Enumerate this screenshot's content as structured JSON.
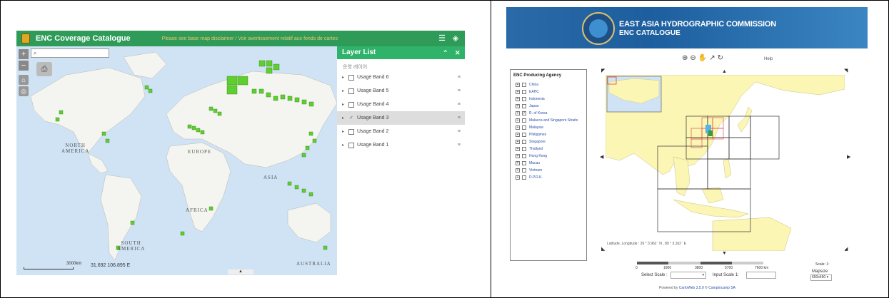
{
  "left": {
    "header": {
      "title": "ENC Coverage Catalogue",
      "disclaimer": "Please see base map disclaimer / Voir avertissement relatif aux fonds de cartes"
    },
    "map": {
      "search_icon": "search-icon",
      "zoom_in": "+",
      "zoom_out": "−",
      "labels": {
        "north_america": "NORTH\nAMERICA",
        "europe": "EUROPE",
        "asia": "ASIA",
        "africa": "AFRICA",
        "south_america": "SOUTH\nAMERICA",
        "australia": "AUSTRALIA"
      },
      "scale": "3000km",
      "coordinates": "31.692 106.895 E",
      "coverage_color": "#5fcf2f"
    },
    "layer_list": {
      "title": "Layer List",
      "subtitle": "운영 레이어",
      "items": [
        {
          "label": "Usage Band 6",
          "checked": false,
          "active": false
        },
        {
          "label": "Usage Band 5",
          "checked": false,
          "active": false
        },
        {
          "label": "Usage Band 4",
          "checked": false,
          "active": false
        },
        {
          "label": "Usage Band 3",
          "checked": true,
          "active": true
        },
        {
          "label": "Usage Band 2",
          "checked": false,
          "active": false
        },
        {
          "label": "Usage Band 1",
          "checked": false,
          "active": false
        }
      ]
    }
  },
  "right": {
    "banner": {
      "title_line1": "EAST ASIA HYDROGRAPHIC COMMISSION",
      "title_line2": "ENC CATALOGUE"
    },
    "toolbar": {
      "icons": [
        "zoom-in-icon",
        "zoom-out-icon",
        "pan-icon",
        "select-icon",
        "refresh-icon"
      ],
      "help": "Help"
    },
    "sidebar": {
      "title": "ENC Producing Agency",
      "items": [
        {
          "label": "China",
          "checked": false
        },
        {
          "label": "EAHC",
          "checked": false
        },
        {
          "label": "Indonesia",
          "checked": false
        },
        {
          "label": "Japan",
          "checked": false
        },
        {
          "label": "R. of Korea",
          "checked": true
        },
        {
          "label": "Malacca and Singapore Straits",
          "checked": false
        },
        {
          "label": "Malaysia",
          "checked": false
        },
        {
          "label": "Philippines",
          "checked": false
        },
        {
          "label": "Singapore",
          "checked": false
        },
        {
          "label": "Thailand",
          "checked": false
        },
        {
          "label": "Hong Kong",
          "checked": false
        },
        {
          "label": "Macau",
          "checked": false
        },
        {
          "label": "Vietnam",
          "checked": false
        },
        {
          "label": "D.P.R.K.",
          "checked": false
        }
      ]
    },
    "map": {
      "coordinates": "Latitude, Longitude : 26 ° 3.962 ' N ,  89 ° 3.162 ' E",
      "land_color": "#fbf6b4"
    },
    "scale": {
      "ticks": [
        "0",
        "1900",
        "3800",
        "5700",
        "7600 km"
      ],
      "select_label": "Select Scale :",
      "input_label": "Input Scale  1:",
      "scale_caption": "Scale: 1:",
      "mapsize_label": "Mapsize",
      "mapsize_value": "650x450"
    },
    "footer": {
      "prefix": "Powered by ",
      "cartoweb": "CartoWeb 3.5.0",
      "sep": " © ",
      "camptocamp": "Camptocamp SA"
    }
  }
}
